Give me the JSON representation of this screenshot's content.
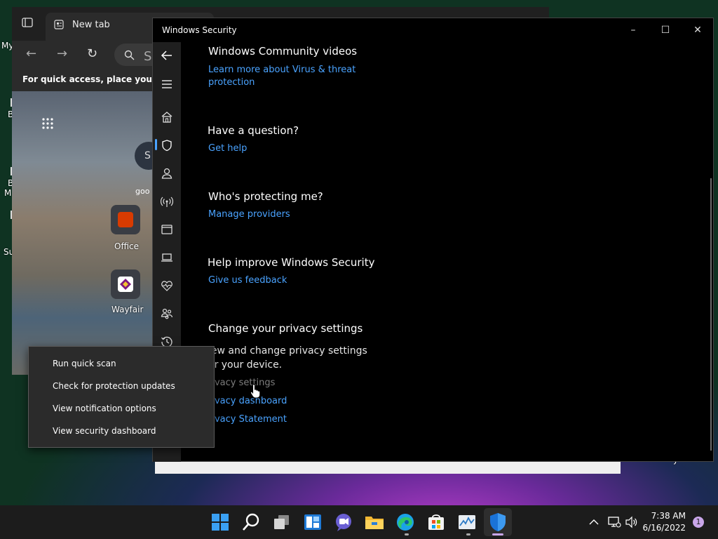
{
  "desktop": {
    "labels": [
      "My",
      "B",
      "B",
      "M",
      "Su"
    ],
    "right_fragment": "y"
  },
  "browser": {
    "tab_title": "New tab",
    "address_placeholder": "Se",
    "favorites_hint": "For quick access, place your favori",
    "search_circle_text": "S",
    "goo_label": "goo",
    "tiles": [
      {
        "label": "Office",
        "icon": "office-icon",
        "color": "#d83b01"
      },
      {
        "label": "Wayfair",
        "icon": "wayfair-icon",
        "color": "#7f187f"
      }
    ]
  },
  "window": {
    "title": "Windows Security",
    "minimize": "–",
    "maximize": "☐",
    "close": "✕"
  },
  "nav": [
    {
      "name": "back",
      "icon": "back-arrow-icon"
    },
    {
      "name": "menu",
      "icon": "hamburger-icon"
    },
    {
      "name": "home",
      "icon": "home-icon"
    },
    {
      "name": "virus-threat-protection",
      "icon": "shield-icon",
      "selected": true
    },
    {
      "name": "account-protection",
      "icon": "person-icon"
    },
    {
      "name": "firewall-network",
      "icon": "wifi-antenna-icon"
    },
    {
      "name": "app-browser-control",
      "icon": "app-window-icon"
    },
    {
      "name": "device-security",
      "icon": "laptop-icon"
    },
    {
      "name": "device-performance",
      "icon": "heart-pulse-icon"
    },
    {
      "name": "family-options",
      "icon": "family-icon"
    },
    {
      "name": "protection-history",
      "icon": "history-icon"
    }
  ],
  "sections": {
    "community": {
      "title": "Windows Community videos",
      "link_line1": "Learn more about Virus & threat",
      "link_line2": "protection"
    },
    "question": {
      "title": "Have a question?",
      "link": "Get help"
    },
    "protecting": {
      "title": "Who's protecting me?",
      "link": "Manage providers"
    },
    "improve": {
      "title": "Help improve Windows Security",
      "link": "Give us feedback"
    },
    "privacy": {
      "title": "Change your privacy settings",
      "text_line1": "iew and change privacy settings",
      "text_line2": "or your  device.",
      "links": [
        "rivacy settings",
        "rivacy dashboard",
        "rivacy Statement"
      ]
    }
  },
  "context_menu": {
    "items": [
      "Run quick scan",
      "Check for protection updates",
      "View notification options",
      "View security dashboard"
    ]
  },
  "taskbar": {
    "apps": [
      "start-icon",
      "search-icon",
      "task-view-icon",
      "widgets-icon",
      "teams-chat-icon",
      "file-explorer-icon",
      "edge-icon",
      "store-icon",
      "task-manager-icon",
      "windows-security-icon"
    ],
    "time": "7:38 AM",
    "date": "6/16/2022",
    "notification_count": "1"
  },
  "colors": {
    "accent_link": "#4aa3ff",
    "window_bg": "#000000",
    "rail_bg": "#1f1f1f",
    "taskbar_bg": "#1c1c1c"
  }
}
